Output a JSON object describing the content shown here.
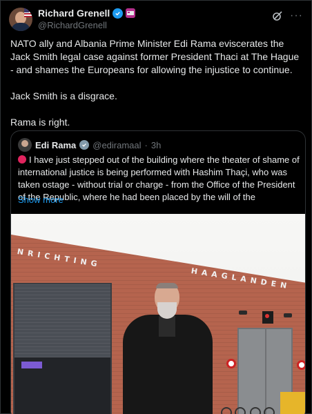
{
  "author": {
    "name": "Richard Grenell",
    "handle": "@RichardGrenell",
    "verified_icon": "verified-badge-icon",
    "affiliate_icon": "affiliate-badge-icon"
  },
  "actions": {
    "grok_icon": "grok-icon",
    "more_label": "···"
  },
  "tweet": {
    "paragraphs": [
      "NATO ally and Albania Prime Minister Edi Rama eviscerates the Jack Smith legal case against former President Thaci at The Hague - and shames the Europeans for allowing the injustice to continue.",
      "Jack Smith is a disgrace.",
      "Rama is right."
    ]
  },
  "quote": {
    "name": "Edi Rama",
    "handle": "@ediramaal",
    "separator": "·",
    "time": "3h",
    "text": "I have just stepped out of the building where the theater of shame of international justice is being performed with Hashim Thaçi, who was taken ostage - without trial or charge - from the Office of the President of the Republic, where he had been placed by the will of the",
    "show_more": "Show more",
    "photo_sign_1": "NRICHTING",
    "photo_sign_2": "HAAGLANDEN"
  },
  "colors": {
    "background": "#000000",
    "text": "#e7e9ea",
    "secondary": "#71767b",
    "link": "#1d9bf0",
    "border": "#2f3336"
  }
}
